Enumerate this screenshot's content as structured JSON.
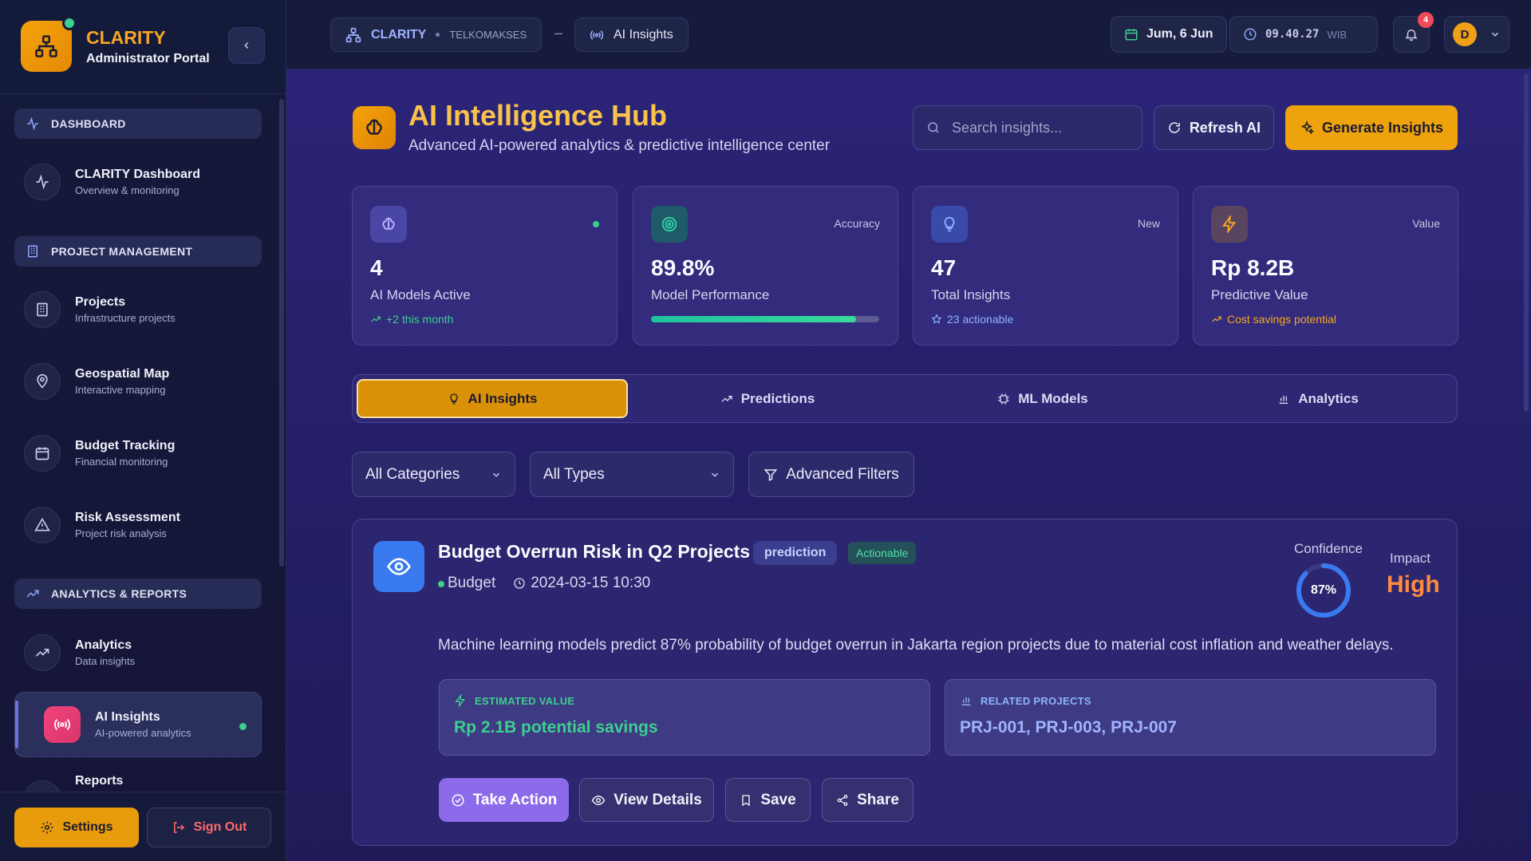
{
  "brand": {
    "name": "CLARITY",
    "subtitle": "Administrator Portal"
  },
  "sidebar": {
    "sections": [
      {
        "label": "DASHBOARD",
        "icon": "activity-icon"
      },
      {
        "label": "PROJECT MANAGEMENT",
        "icon": "building-icon"
      },
      {
        "label": "ANALYTICS & REPORTS",
        "icon": "trending-up-icon"
      }
    ],
    "items": [
      {
        "title": "CLARITY Dashboard",
        "desc": "Overview & monitoring",
        "icon": "activity-icon"
      },
      {
        "title": "Projects",
        "desc": "Infrastructure projects",
        "icon": "building-icon"
      },
      {
        "title": "Geospatial Map",
        "desc": "Interactive mapping",
        "icon": "map-pin-icon"
      },
      {
        "title": "Budget Tracking",
        "desc": "Financial monitoring",
        "icon": "calendar-icon"
      },
      {
        "title": "Risk Assessment",
        "desc": "Project risk analysis",
        "icon": "alert-triangle-icon"
      },
      {
        "title": "Analytics",
        "desc": "Data insights",
        "icon": "trending-up-icon"
      },
      {
        "title": "AI Insights",
        "desc": "AI-powered analytics",
        "icon": "radio-icon",
        "active": true
      },
      {
        "title": "Reports",
        "desc": "",
        "icon": "file-icon"
      }
    ],
    "settings_label": "Settings",
    "signout_label": "Sign Out"
  },
  "topbar": {
    "crumb_main": "CLARITY",
    "crumb_sub": "TELKOMAKSES",
    "crumb_sep": "–",
    "crumb_page": "AI Insights",
    "date": "Jum, 6 Jun",
    "time": "09.40.27",
    "timezone": "WIB",
    "notifications": "4",
    "user_initial": "D"
  },
  "hub": {
    "title": "AI Intelligence Hub",
    "subtitle": "Advanced AI-powered analytics & predictive intelligence center",
    "search_placeholder": "Search insights...",
    "refresh_label": "Refresh AI",
    "generate_label": "Generate Insights"
  },
  "stats": [
    {
      "value": "4",
      "label": "AI Models Active",
      "tag": "",
      "foot": "+2 this month",
      "icon": "brain-icon",
      "accent": "#a8a4ff"
    },
    {
      "value": "89.8%",
      "label": "Model Performance",
      "tag": "Accuracy",
      "foot": "",
      "progress": 0.898,
      "icon": "target-icon",
      "accent": "#2fd4a6"
    },
    {
      "value": "47",
      "label": "Total Insights",
      "tag": "New",
      "foot": "23 actionable",
      "icon": "lightbulb-icon",
      "accent": "#8fb4ff"
    },
    {
      "value": "Rp 8.2B",
      "label": "Predictive Value",
      "tag": "Value",
      "foot": "Cost savings potential",
      "icon": "zap-icon",
      "accent": "#f5a623"
    }
  ],
  "tabs": [
    {
      "label": "AI Insights",
      "icon": "lightbulb-icon",
      "active": true
    },
    {
      "label": "Predictions",
      "icon": "trending-up-icon"
    },
    {
      "label": "ML Models",
      "icon": "cpu-icon"
    },
    {
      "label": "Analytics",
      "icon": "bar-chart-icon"
    }
  ],
  "filters": {
    "category": "All Categories",
    "type": "All Types",
    "advanced_label": "Advanced Filters"
  },
  "insight": {
    "title": "Budget Overrun Risk in Q2 Projects",
    "badge_type": "prediction",
    "badge_status": "Actionable",
    "category": "Budget",
    "timestamp": "2024-03-15 10:30",
    "confidence_label": "Confidence",
    "confidence": "87%",
    "confidence_value": 0.87,
    "impact_label": "Impact",
    "impact": "High",
    "description": "Machine learning models predict 87% probability of budget overrun in Jakarta region projects due to material cost inflation and weather delays.",
    "estimated_label": "ESTIMATED VALUE",
    "estimated_value": "Rp 2.1B potential savings",
    "related_label": "RELATED PROJECTS",
    "related_value": "PRJ-001, PRJ-003, PRJ-007",
    "actions": {
      "take": "Take Action",
      "view": "View Details",
      "save": "Save",
      "share": "Share"
    }
  },
  "colors": {
    "accent": "#f5a623",
    "success": "#3ecf8e",
    "danger": "#ef4a5a",
    "primary": "#8c6bea"
  }
}
